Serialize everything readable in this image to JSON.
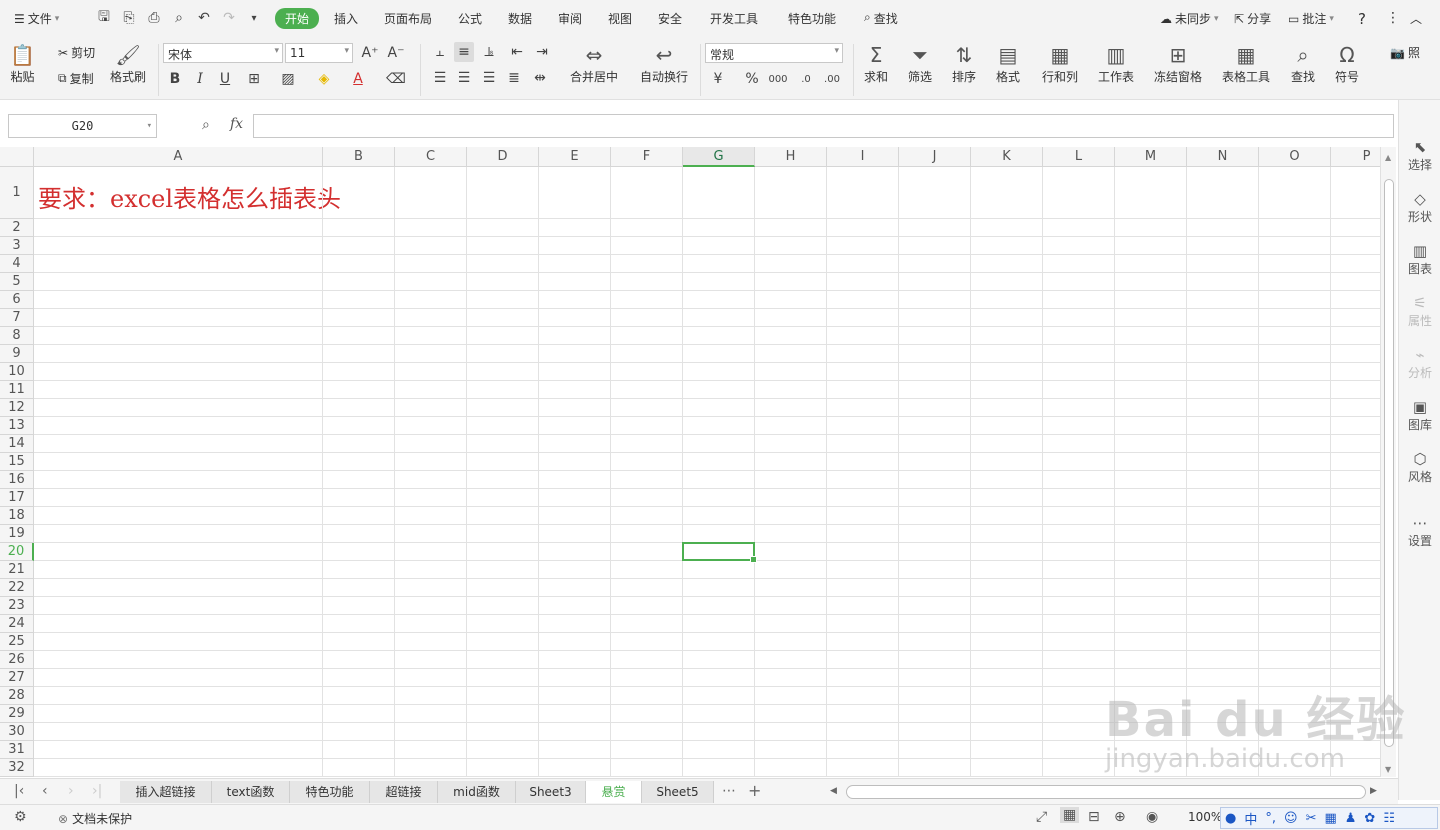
{
  "app": {
    "file_menu": "文件",
    "tabs": [
      "开始",
      "插入",
      "页面布局",
      "公式",
      "数据",
      "审阅",
      "视图",
      "安全",
      "开发工具",
      "特色功能"
    ],
    "search": "查找",
    "right": {
      "sync": "未同步",
      "share": "分享",
      "comment": "批注",
      "help": "?"
    }
  },
  "ribbon": {
    "paste": "粘贴",
    "cut": "剪切",
    "copy": "复制",
    "format_painter": "格式刷",
    "font_name": "宋体",
    "font_size": "11",
    "merge_center": "合并居中",
    "wrap_text": "自动换行",
    "number_format": "常规",
    "sum": "求和",
    "filter": "筛选",
    "sort": "排序",
    "format": "格式",
    "row_col": "行和列",
    "worksheet": "工作表",
    "freeze": "冻结窗格",
    "table_tools": "表格工具",
    "find": "查找",
    "symbol": "符号",
    "photo": "照"
  },
  "formula_bar": {
    "name_box": "G20",
    "fx": "fx",
    "value": ""
  },
  "grid": {
    "columns": [
      "A",
      "B",
      "C",
      "D",
      "E",
      "F",
      "G",
      "H",
      "I",
      "J",
      "K",
      "L",
      "M",
      "N",
      "O",
      "P"
    ],
    "rows": [
      "1",
      "2",
      "3",
      "4",
      "5",
      "6",
      "7",
      "8",
      "9",
      "10",
      "11",
      "12",
      "13",
      "14",
      "15",
      "16",
      "17",
      "18",
      "19",
      "20",
      "21",
      "22",
      "23",
      "24",
      "25",
      "26",
      "27",
      "28",
      "29",
      "30",
      "31",
      "32"
    ],
    "selected_col": "G",
    "selected_row": "20",
    "a1_text": "要求：excel表格怎么插表头"
  },
  "sidebar": {
    "items": [
      {
        "label": "选择",
        "icon": "pointer-icon"
      },
      {
        "label": "形状",
        "icon": "shape-icon"
      },
      {
        "label": "图表",
        "icon": "chart-icon"
      },
      {
        "label": "属性",
        "icon": "properties-icon"
      },
      {
        "label": "分析",
        "icon": "analysis-icon"
      },
      {
        "label": "图库",
        "icon": "gallery-icon"
      },
      {
        "label": "风格",
        "icon": "style-icon"
      },
      {
        "label": "设置",
        "icon": "settings-icon"
      }
    ]
  },
  "sheets": [
    "插入超链接",
    "text函数",
    "特色功能",
    "超链接",
    "mid函数",
    "Sheet3",
    "悬赏",
    "Sheet5"
  ],
  "active_sheet": "悬赏",
  "status": {
    "protect": "文档未保护",
    "zoom": "100%",
    "ime": "中"
  },
  "watermark": {
    "line1": "Bai du 经验",
    "line2": "jingyan.baidu.com"
  },
  "colors": {
    "accent": "#4caf50",
    "title_red": "#d32f2f"
  }
}
